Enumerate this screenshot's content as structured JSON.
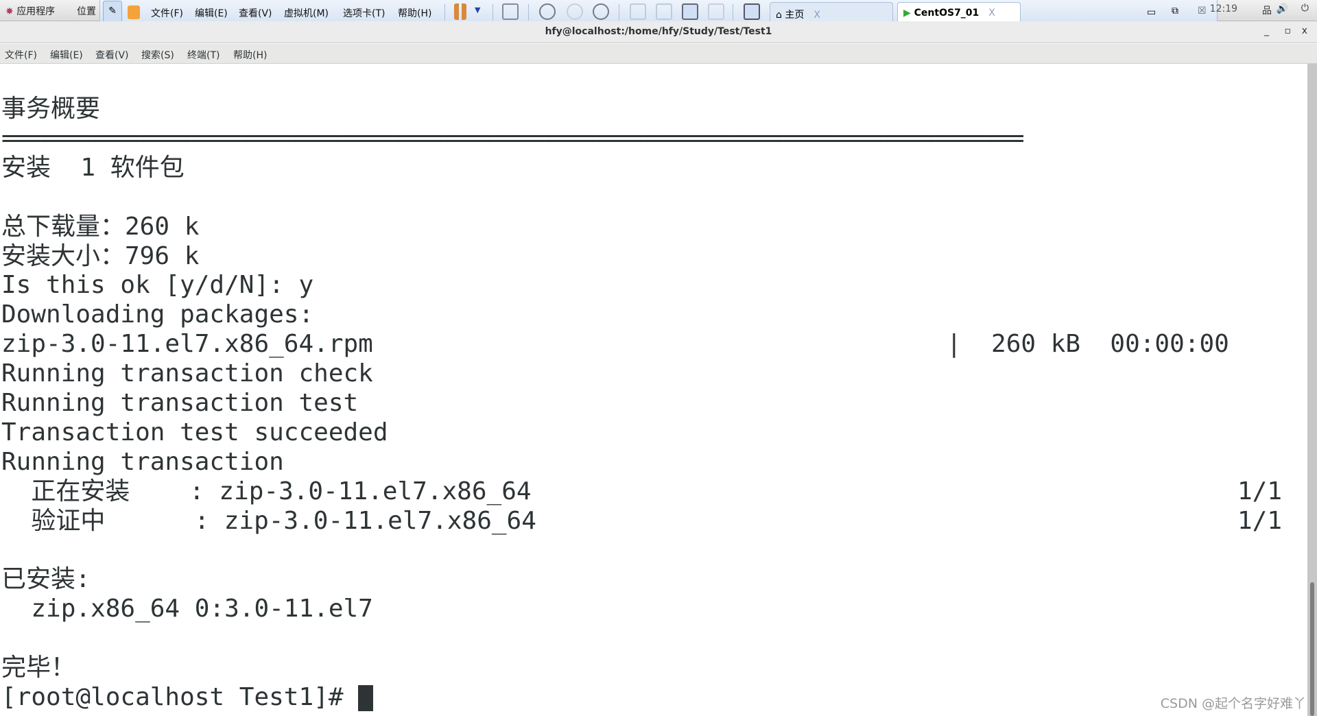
{
  "panel": {
    "apps": "应用程序",
    "places": "位置",
    "clock": "12:19"
  },
  "vmware": {
    "menus": [
      "文件(F)",
      "编辑(E)",
      "查看(V)",
      "虚拟机(M)",
      "选项卡(T)",
      "帮助(H)"
    ],
    "tabs": [
      {
        "label": "主页"
      },
      {
        "label": "CentOS7_01"
      }
    ],
    "close": "X"
  },
  "window": {
    "title": "hfy@localhost:/home/hfy/Study/Test/Test1",
    "min": "_",
    "max": "▫",
    "close": "x"
  },
  "menubar": [
    "文件(F)",
    "编辑(E)",
    "查看(V)",
    "搜索(S)",
    "终端(T)",
    "帮助(H)"
  ],
  "terminal": {
    "lines": [
      "事务概要",
      "=================================================================================",
      "安装  1 软件包",
      "",
      "总下载量：260 k",
      "安装大小：796 k",
      "Is this ok [y/d/N]: y",
      "Downloading packages:",
      "zip-3.0-11.el7.x86_64.rpm",
      "Running transaction check",
      "Running transaction test",
      "Transaction test succeeded",
      "Running transaction",
      "  正在安装    : zip-3.0-11.el7.x86_64",
      "  验证中      : zip-3.0-11.el7.x86_64",
      "",
      "已安装:",
      "  zip.x86_64 0:3.0-11.el7",
      "",
      "完毕！",
      "[root@localhost Test1]# "
    ],
    "download_info": "|  260 kB  00:00:00",
    "progress": [
      "1/1",
      "1/1"
    ]
  },
  "watermark": "CSDN @起个名字好难丫"
}
